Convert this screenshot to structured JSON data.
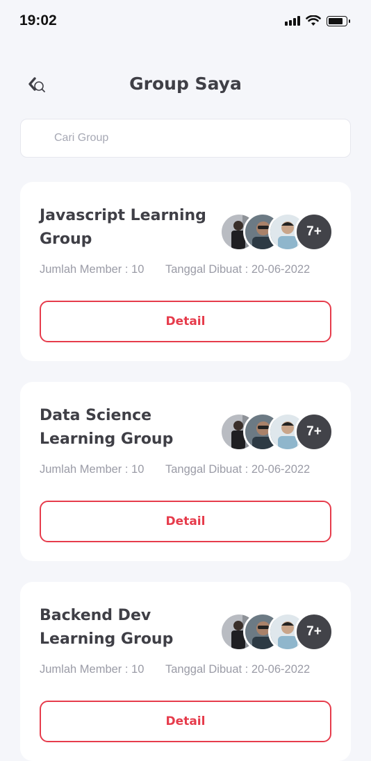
{
  "status_bar": {
    "time": "19:02",
    "icons": [
      "signal-icon",
      "wifi-icon",
      "battery-icon"
    ]
  },
  "header": {
    "title": "Group Saya",
    "back_icon": "back-arrow-icon"
  },
  "search": {
    "placeholder": "Cari Group",
    "value": ""
  },
  "groups": [
    {
      "name": "Javascript Learning Group",
      "member_label": "Jumlah Member : 10",
      "created_label": "Tanggal Dibuat : 20-06-2022",
      "more_members": "7+",
      "detail_label": "Detail"
    },
    {
      "name": "Data Science Learning Group",
      "member_label": "Jumlah Member : 10",
      "created_label": "Tanggal Dibuat : 20-06-2022",
      "more_members": "7+",
      "detail_label": "Detail"
    },
    {
      "name": "Backend Dev Learning Group",
      "member_label": "Jumlah Member : 10",
      "created_label": "Tanggal Dibuat : 20-06-2022",
      "more_members": "7+",
      "detail_label": "Detail"
    }
  ],
  "colors": {
    "accent": "#e63b4b",
    "background": "#f5f6fa",
    "title_text": "#3f3f46",
    "muted_text": "#9a9ba6",
    "badge": "#424349"
  }
}
